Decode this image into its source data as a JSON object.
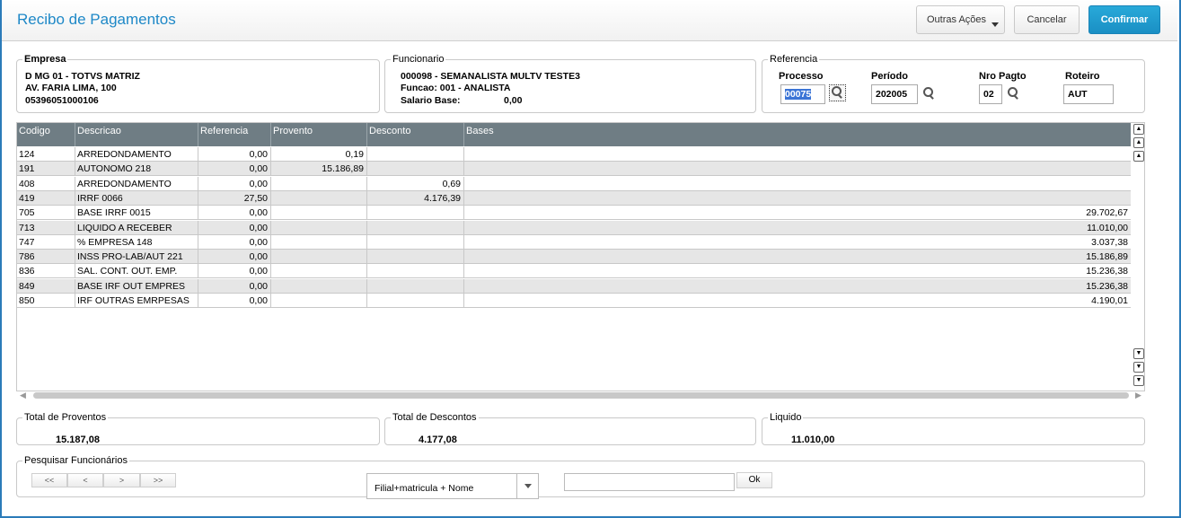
{
  "header": {
    "title": "Recibo de Pagamentos",
    "outras_acoes": "Outras Ações",
    "cancelar": "Cancelar",
    "confirmar": "Confirmar"
  },
  "empresa": {
    "legend": "Empresa",
    "line1": "D MG 01  - TOTVS MATRIZ",
    "line2": "AV. FARIA LIMA, 100",
    "line3": "05396051000106"
  },
  "funcionario": {
    "legend": "Funcionario",
    "line1": "000098 - SEMANALISTA MULTV TESTE3",
    "line2": "Funcao: 001   - ANALISTA",
    "salario_label": "Salario Base:",
    "salario_value": "0,00"
  },
  "referencia": {
    "legend": "Referencia",
    "processo_label": "Processo",
    "processo_value": "00075",
    "periodo_label": "Período",
    "periodo_value": "202005",
    "nro_pagto_label": "Nro Pagto",
    "nro_pagto_value": "02",
    "roteiro_label": "Roteiro",
    "roteiro_value": "AUT"
  },
  "grid": {
    "columns": [
      "Codigo",
      "Descricao",
      "Referencia",
      "Provento",
      "Desconto",
      "Bases"
    ],
    "rows": [
      [
        "124",
        "ARREDONDAMENTO",
        "0,00",
        "0,19",
        "",
        ""
      ],
      [
        "191",
        "AUTONOMO 218",
        "0,00",
        "15.186,89",
        "",
        ""
      ],
      [
        "408",
        "ARREDONDAMENTO",
        "0,00",
        "",
        "0,69",
        ""
      ],
      [
        "419",
        "IRRF 0066",
        "27,50",
        "",
        "4.176,39",
        ""
      ],
      [
        "705",
        "BASE IRRF 0015",
        "0,00",
        "",
        "",
        "29.702,67"
      ],
      [
        "713",
        "LIQUIDO A RECEBER",
        "0,00",
        "",
        "",
        "11.010,00"
      ],
      [
        "747",
        "% EMPRESA  148",
        "0,00",
        "",
        "",
        "3.037,38"
      ],
      [
        "786",
        "INSS PRO-LAB/AUT 221",
        "0,00",
        "",
        "",
        "15.186,89"
      ],
      [
        "836",
        "SAL. CONT. OUT. EMP.",
        "0,00",
        "",
        "",
        "15.236,38"
      ],
      [
        "849",
        "BASE IRF OUT EMPRES",
        "0,00",
        "",
        "",
        "15.236,38"
      ],
      [
        "850",
        "IRF OUTRAS EMRPESAS",
        "0,00",
        "",
        "",
        "4.190,01"
      ]
    ]
  },
  "totals": {
    "proventos_label": "Total de Proventos",
    "proventos_value": "15.187,08",
    "descontos_label": "Total de Descontos",
    "descontos_value": "4.177,08",
    "liquido_label": "Liquido",
    "liquido_value": "11.010,00"
  },
  "pesquisar": {
    "legend": "Pesquisar Funcionários",
    "first": "<<",
    "prev": "<",
    "next": ">",
    "last": ">>",
    "order_select": "Filial+matricula + Nome",
    "search_value": "",
    "ok": "Ok"
  }
}
